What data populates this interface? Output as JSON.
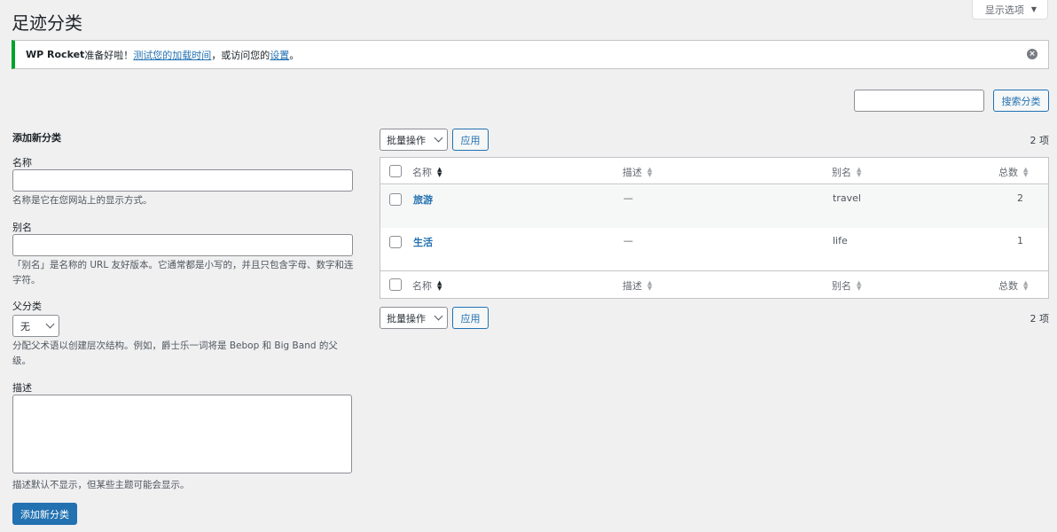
{
  "header": {
    "title": "足迹分类",
    "screen_options": "显示选项"
  },
  "notice": {
    "brand": "WP Rocket",
    "text1": "准备好啦！",
    "link1": "测试您的加载时间",
    "text2": "，或访问您的",
    "link2": "设置",
    "text3": "。"
  },
  "search": {
    "button": "搜索分类",
    "value": ""
  },
  "form": {
    "heading": "添加新分类",
    "name_label": "名称",
    "name_help": "名称是它在您网站上的显示方式。",
    "slug_label": "别名",
    "slug_help": "「别名」是名称的 URL 友好版本。它通常都是小写的，并且只包含字母、数字和连字符。",
    "parent_label": "父分类",
    "parent_value": "无",
    "parent_help": "分配父术语以创建层次结构。例如，爵士乐一词将是 Bebop 和 Big Band 的父级。",
    "desc_label": "描述",
    "desc_help": "描述默认不显示，但某些主题可能会显示。",
    "submit": "添加新分类"
  },
  "table": {
    "bulk_label": "批量操作",
    "apply": "应用",
    "count": "2 项",
    "columns": [
      "名称",
      "描述",
      "别名",
      "总数"
    ],
    "rows": [
      {
        "name": "旅游",
        "description": "—",
        "slug": "travel",
        "count": "2"
      },
      {
        "name": "生活",
        "description": "—",
        "slug": "life",
        "count": "1"
      }
    ]
  },
  "colors": {
    "accent": "#2271b1",
    "notice_success": "#00a32a",
    "background": "#f0f0f1"
  }
}
